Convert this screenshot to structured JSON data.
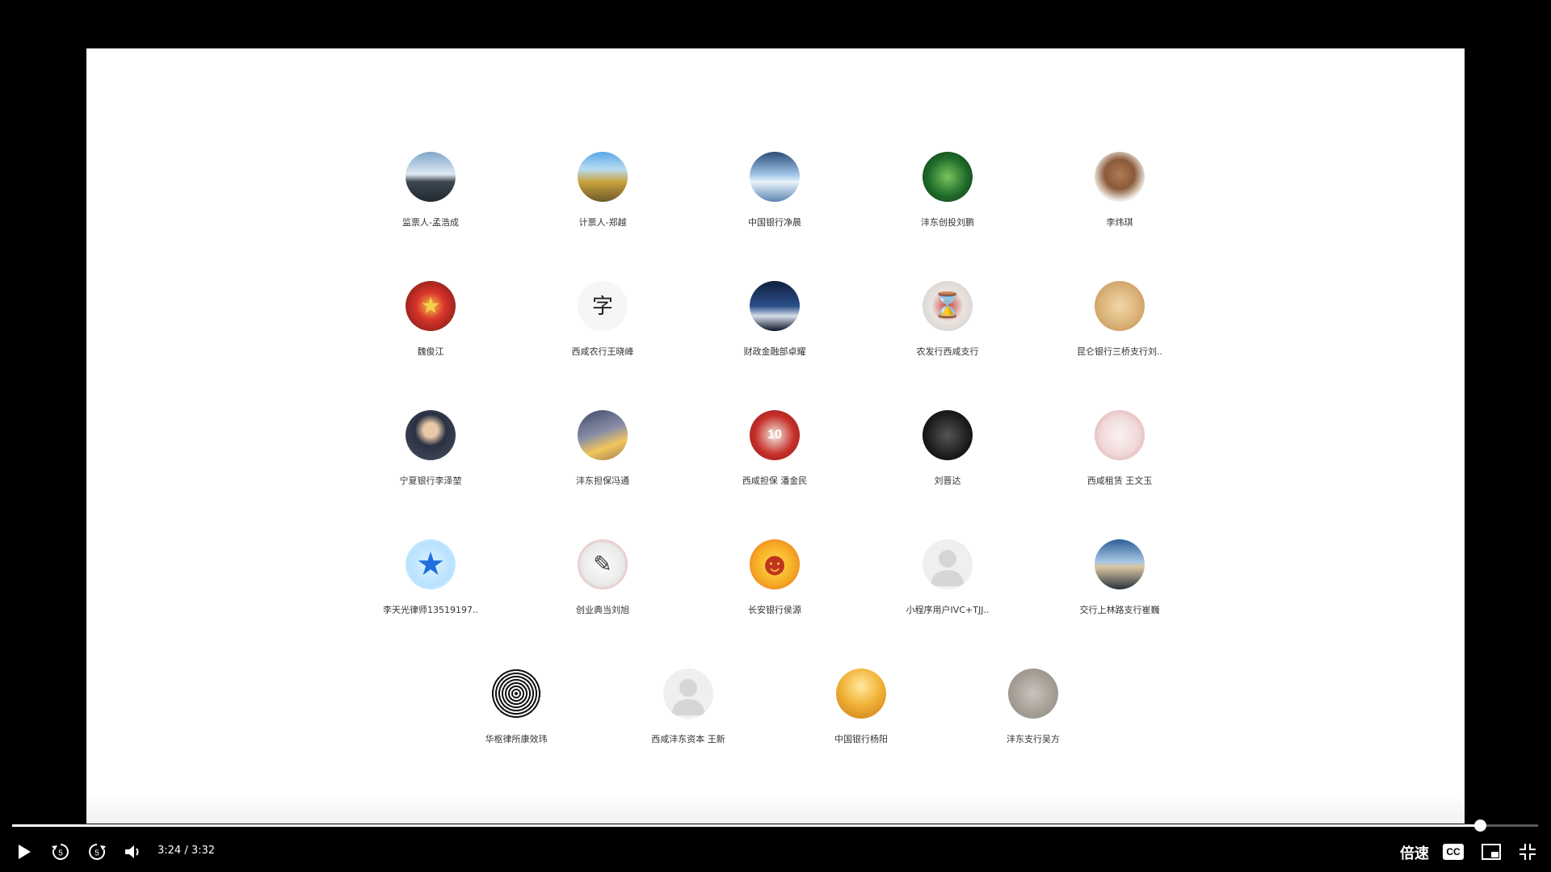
{
  "members": [
    {
      "name": "监票人-孟浩成",
      "icon": "sunset-lake-avatar",
      "bg": "linear-gradient(#7fa7c9 0%,#dfe9f2 45%,#3d4650 60%,#1f2a33 100%)",
      "glyph": ""
    },
    {
      "name": "计票人-郑越",
      "icon": "road-avatar",
      "bg": "linear-gradient(#5aa7e6 0%,#b8dcf2 35%,#c8a23c 60%,#6f5a2a 100%)",
      "glyph": ""
    },
    {
      "name": "中国银行净晨",
      "icon": "ice-avatar",
      "bg": "linear-gradient(#2d4d77 0%,#9ec3e6 45%,#e8f3fb 60%,#5b86b0 100%)",
      "glyph": ""
    },
    {
      "name": "沣东创投刘鹏",
      "icon": "forest-avatar",
      "bg": "radial-gradient(circle,#7cc45d 0%,#1f6b2a 55%,#0c3312 100%)",
      "glyph": ""
    },
    {
      "name": "李炜琪",
      "icon": "figurine-avatar",
      "bg": "radial-gradient(circle at 50% 45%,#b07a55 0%,#8a5a3a 40%,#efe9e2 70%)",
      "glyph": ""
    },
    {
      "name": "魏俊江",
      "icon": "emblem-avatar",
      "bg": "radial-gradient(circle,#f2c14a 0%,#d8332a 40%,#6a1a14 100%)",
      "glyph": "★"
    },
    {
      "name": "西咸农行王晓峰",
      "icon": "calligraphy-avatar",
      "bg": "#f6f6f4",
      "glyph": "字"
    },
    {
      "name": "财政金融部卓耀",
      "icon": "mountain-night-avatar",
      "bg": "linear-gradient(#0f1e3c 0%,#2a4f8a 50%,#d6dde8 70%,#0b1426 100%)",
      "glyph": ""
    },
    {
      "name": "农发行西咸支行",
      "icon": "hourglass-avatar",
      "bg": "radial-gradient(circle,#d03a32 0%,#e9e4e0 45%,#cfcac6 100%)",
      "glyph": "⌛"
    },
    {
      "name": "昆仑银行三桥支行刘..",
      "icon": "tiger-avatar",
      "bg": "radial-gradient(circle,#f2d8a8 0%,#d8ae74 60%,#b98a4e 100%)",
      "glyph": ""
    },
    {
      "name": "宁夏银行李泽堃",
      "icon": "person-suit-avatar",
      "bg": "radial-gradient(circle at 50% 40%,#e7c9a9 0%,#e7c9a9 18%,#2a3142 40%,#4a5060 100%)",
      "glyph": ""
    },
    {
      "name": "沣东担保冯通",
      "icon": "sky-avatar",
      "bg": "linear-gradient(160deg,#3d4a66 0%,#8a8fa8 45%,#f2c65a 70%,#9a7a56 100%)",
      "glyph": ""
    },
    {
      "name": "西咸担保 潘金民",
      "icon": "jersey-avatar",
      "bg": "radial-gradient(circle,#f1ece4 0%,#c7302a 55%,#8a1d1b 100%)",
      "glyph": "10"
    },
    {
      "name": "刘晋达",
      "icon": "helmet-avatar",
      "bg": "radial-gradient(circle,#555 0%,#1c1c1c 60%,#000 100%)",
      "glyph": ""
    },
    {
      "name": "西咸租赁 王文玉",
      "icon": "poodle-avatar",
      "bg": "radial-gradient(circle,#fbf2f2 0%,#f0d8d8 55%,#d79a9a 100%)",
      "glyph": ""
    },
    {
      "name": "李天光律师13519197..",
      "icon": "star-avatar",
      "bg": "radial-gradient(circle,#dff2ff 0%,#b7e2ff 60%,#e6f6ff 100%)",
      "glyph": "★"
    },
    {
      "name": "创业典当刘旭",
      "icon": "sketch-avatar",
      "bg": "radial-gradient(circle,#fdfdfd 0%,#e9e9e9 60%,#d96a5c 100%)",
      "glyph": "✎"
    },
    {
      "name": "长安银行侯源",
      "icon": "cartoon-face-avatar",
      "bg": "radial-gradient(circle,#ffe04a 0%,#f5a623 60%,#e05a2a 100%)",
      "glyph": "☻"
    },
    {
      "name": "小程序用户IVC+TJJ..",
      "icon": "default-user-avatar",
      "bg": "#efefef",
      "glyph": ""
    },
    {
      "name": "交行上林路支行崔巍",
      "icon": "seaside-avatar",
      "bg": "linear-gradient(#2c5f9a 0%,#a8c7e3 45%,#d9c7a2 55%,#26313d 100%)",
      "glyph": ""
    },
    {
      "name": "华枢律所康效玮",
      "icon": "fingerprint-avatar",
      "bg": "repeating-radial-gradient(circle,#111 0px,#111 2px,#fafafa 2px,#fafafa 4px)",
      "glyph": ""
    },
    {
      "name": "西咸沣东资本 王新",
      "icon": "default-user-avatar",
      "bg": "#efefef",
      "glyph": ""
    },
    {
      "name": "中国银行杨阳",
      "icon": "silhouette-sunset-avatar",
      "bg": "radial-gradient(circle at 50% 35%,#ffe9a0 0%,#f2b53b 45%,#c97a12 100%)",
      "glyph": ""
    },
    {
      "name": "沣东支行吴方",
      "icon": "stone-avatar",
      "bg": "radial-gradient(circle,#c9c4bc 0%,#a59f96 55%,#8e8880 100%)",
      "glyph": ""
    }
  ],
  "player": {
    "time": "3:24 / 3:32",
    "progress": 0.962,
    "speed_label": "倍速",
    "cc_label": "CC",
    "rewind_label": "5",
    "forward_label": "5"
  }
}
